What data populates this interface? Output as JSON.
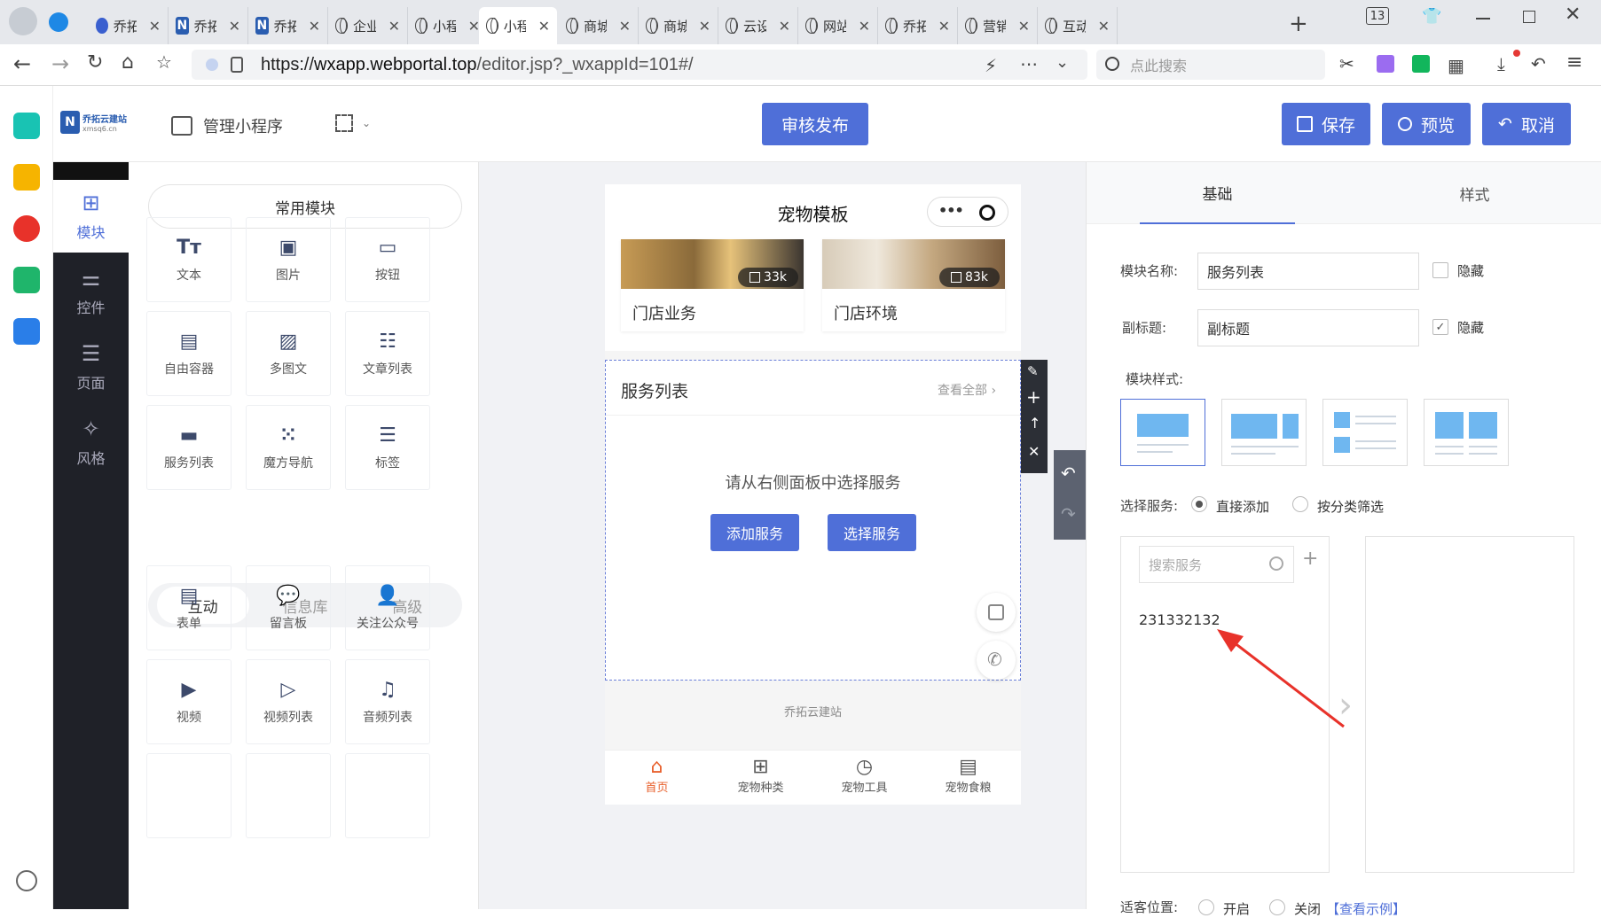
{
  "browser": {
    "tab_count": "13",
    "tabs": [
      {
        "label": "乔拓",
        "icon": "paw-icon"
      },
      {
        "label": "乔拓",
        "icon": "n-logo-icon"
      },
      {
        "label": "乔拓",
        "icon": "n-logo-icon"
      },
      {
        "label": "企业",
        "icon": "globe-icon"
      },
      {
        "label": "小程",
        "icon": "globe-icon"
      },
      {
        "label": "小程",
        "icon": "globe-icon"
      },
      {
        "label": "商城",
        "icon": "globe-icon"
      },
      {
        "label": "商城",
        "icon": "globe-icon"
      },
      {
        "label": "云设",
        "icon": "globe-icon"
      },
      {
        "label": "网站",
        "icon": "globe-icon"
      },
      {
        "label": "乔拓",
        "icon": "globe-icon"
      },
      {
        "label": "营销",
        "icon": "globe-icon"
      },
      {
        "label": "互动",
        "icon": "globe-icon"
      }
    ],
    "url": "https://wxapp.webportal.top/editor.jsp?_wxappId=101#/",
    "url_domain": "wxapp.webportal.top",
    "url_prefix": "https://",
    "url_path": "/editor.jsp?_wxappId=101#/",
    "search_placeholder": "点此搜索"
  },
  "header": {
    "logo_text": "乔拓云建站",
    "logo_sub": "xmsq6.cn",
    "manage_label": "管理小程序",
    "publish_label": "审核发布",
    "save_label": "保存",
    "preview_label": "预览",
    "cancel_label": "取消"
  },
  "sidebar": [
    {
      "label": "模块",
      "icon": "plus-square-icon",
      "active": true
    },
    {
      "label": "控件",
      "icon": "sliders-icon",
      "active": false
    },
    {
      "label": "页面",
      "icon": "pages-icon",
      "active": false
    },
    {
      "label": "风格",
      "icon": "magic-wand-icon",
      "active": false
    }
  ],
  "modules": {
    "common_title": "常用模块",
    "common": [
      {
        "label": "文本",
        "icon": "text-icon"
      },
      {
        "label": "图片",
        "icon": "image-icon"
      },
      {
        "label": "按钮",
        "icon": "button-icon"
      },
      {
        "label": "自由容器",
        "icon": "container-icon"
      },
      {
        "label": "多图文",
        "icon": "multi-image-icon"
      },
      {
        "label": "文章列表",
        "icon": "article-list-icon"
      },
      {
        "label": "服务列表",
        "icon": "service-list-icon"
      },
      {
        "label": "魔方导航",
        "icon": "grid-nav-icon"
      },
      {
        "label": "标签",
        "icon": "tabs-icon"
      }
    ],
    "tabs": [
      {
        "label": "互动",
        "active": true
      },
      {
        "label": "信息库",
        "active": false
      },
      {
        "label": "高级",
        "active": false
      }
    ],
    "interactive": [
      {
        "label": "表单",
        "icon": "form-icon"
      },
      {
        "label": "留言板",
        "icon": "message-board-icon"
      },
      {
        "label": "关注公众号",
        "icon": "follow-user-icon"
      },
      {
        "label": "视频",
        "icon": "video-icon"
      },
      {
        "label": "视频列表",
        "icon": "video-list-icon"
      },
      {
        "label": "音频列表",
        "icon": "audio-list-icon"
      }
    ]
  },
  "phone": {
    "title": "宠物模板",
    "cards": [
      {
        "label": "门店业务",
        "views": "33k"
      },
      {
        "label": "门店环境",
        "views": "83k"
      }
    ],
    "service_title": "服务列表",
    "view_all": "查看全部",
    "empty_hint": "请从右侧面板中选择服务",
    "add_service": "添加服务",
    "select_service": "选择服务",
    "footer": "乔拓云建站",
    "nav": [
      {
        "label": "首页",
        "icon": "home-icon",
        "active": true
      },
      {
        "label": "宠物种类",
        "icon": "category-icon",
        "active": false
      },
      {
        "label": "宠物工具",
        "icon": "clock-icon",
        "active": false
      },
      {
        "label": "宠物食粮",
        "icon": "document-icon",
        "active": false
      }
    ]
  },
  "settings": {
    "tabs": [
      {
        "label": "基础",
        "active": true
      },
      {
        "label": "样式",
        "active": false
      }
    ],
    "module_name_label": "模块名称:",
    "module_name_value": "服务列表",
    "hide_label": "隐藏",
    "subtitle_label": "副标题:",
    "subtitle_value": "副标题",
    "subtitle_hidden": true,
    "module_name_hidden": false,
    "style_label": "模块样式:",
    "select_label": "选择服务:",
    "opt_direct": "直接添加",
    "opt_category": "按分类筛选",
    "search_placeholder": "搜索服务",
    "service_item": "231332132",
    "bottom_label": "适客位置:",
    "bottom_opt_on": "开启",
    "bottom_opt_off": "关闭",
    "bottom_link": "【查看示例】"
  },
  "colors": {
    "accent": "#4f6fd8",
    "sidebar_dark": "#1f2128",
    "nav_active": "#e8602c",
    "arrow_red": "#e8322a"
  }
}
